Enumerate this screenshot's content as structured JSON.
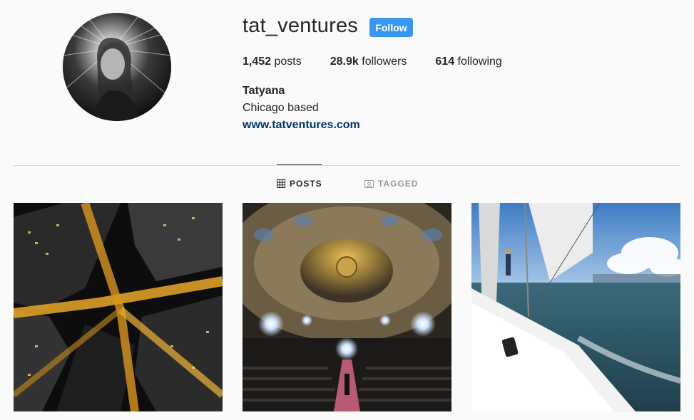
{
  "profile": {
    "username": "tat_ventures",
    "follow_label": "Follow",
    "stats": {
      "posts_count": "1,452",
      "posts_label": "posts",
      "followers_count": "28.9k",
      "followers_label": "followers",
      "following_count": "614",
      "following_label": "following"
    },
    "name": "Tatyana",
    "bio": "Chicago based",
    "website": "www.tatventures.com"
  },
  "tabs": [
    {
      "label": "POSTS",
      "icon": "grid-icon",
      "active": true
    },
    {
      "label": "TAGGED",
      "icon": "tagged-icon",
      "active": false
    }
  ],
  "posts": [
    {
      "icon": "city-aerial-night-photo"
    },
    {
      "icon": "theater-interior-photo"
    },
    {
      "icon": "sailboat-lake-photo"
    }
  ],
  "colors": {
    "follow_button": "#3897f0",
    "link": "#003569",
    "background": "#fafafa",
    "divider": "#dbdbdb"
  }
}
